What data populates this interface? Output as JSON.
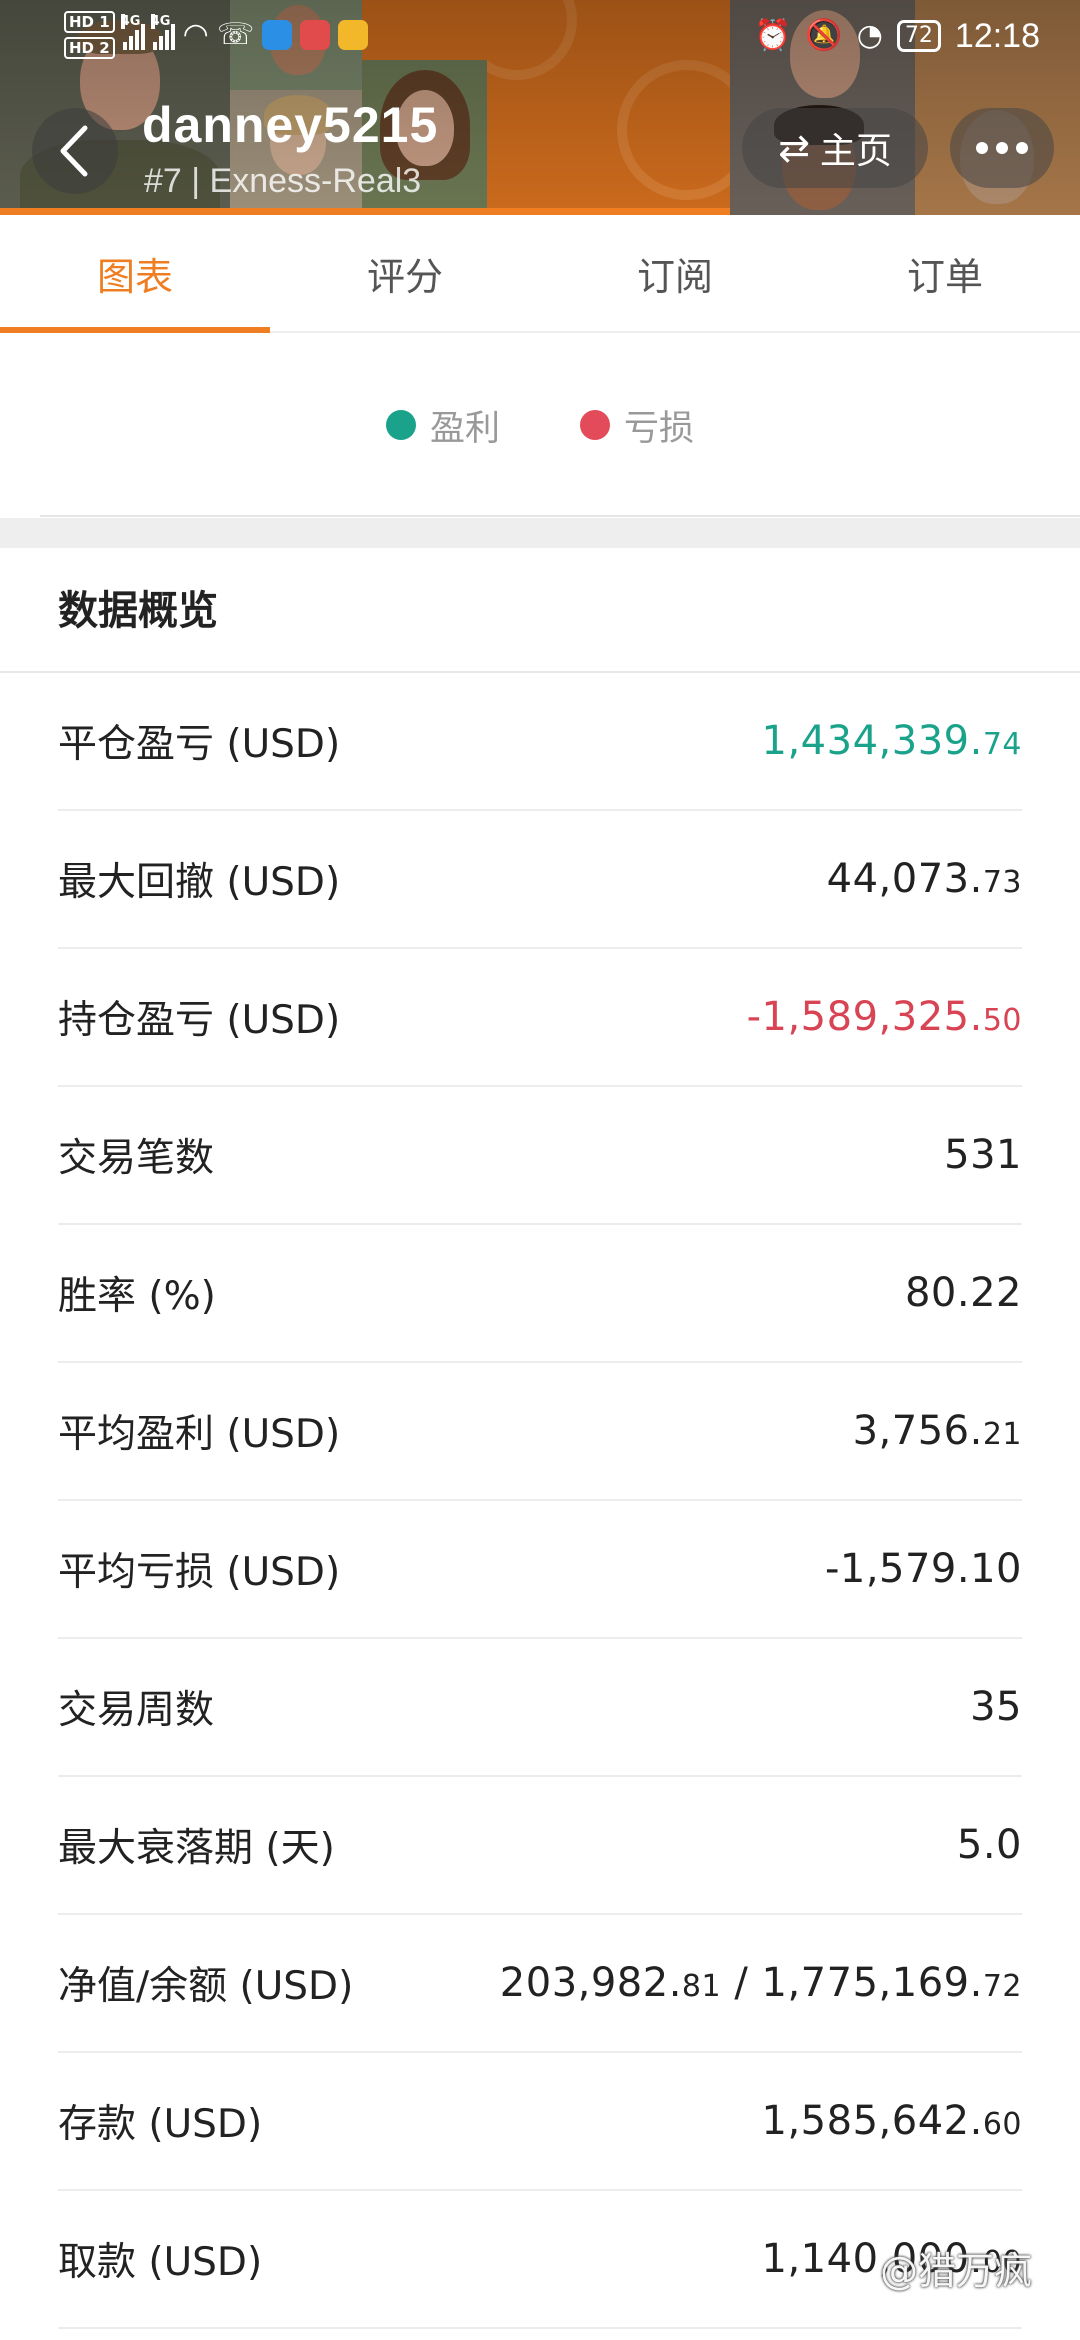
{
  "status_bar": {
    "hd1": "HD 1",
    "hd2": "HD 2",
    "net1": "4G",
    "net2": "4G",
    "battery": "72",
    "time": "12:18"
  },
  "header": {
    "username": "danney5215",
    "subtitle": "#7 | Exness-Real3",
    "home_label": "主页",
    "back_icon": "chevron-left-icon",
    "more_icon": "more-dots-icon"
  },
  "tabs": [
    {
      "label": "图表",
      "active": true
    },
    {
      "label": "评分",
      "active": false
    },
    {
      "label": "订阅",
      "active": false
    },
    {
      "label": "订单",
      "active": false
    }
  ],
  "legend": {
    "profit_label": "盈利",
    "loss_label": "亏损",
    "profit_color": "#1aa38a",
    "loss_color": "#e34a5a"
  },
  "overview": {
    "title": "数据概览",
    "rows": [
      {
        "label": "平仓盈亏 (USD)",
        "int": "1,434,339.",
        "dec": "74",
        "tone": "green"
      },
      {
        "label": "最大回撤 (USD)",
        "int": "44,073.",
        "dec": "73",
        "tone": ""
      },
      {
        "label": "持仓盈亏 (USD)",
        "int": "-1,589,325.",
        "dec": "50",
        "tone": "red"
      },
      {
        "label": "交易笔数",
        "int": "531",
        "dec": "",
        "tone": ""
      },
      {
        "label": "胜率 (%)",
        "int": "80.22",
        "dec": "",
        "tone": ""
      },
      {
        "label": "平均盈利 (USD)",
        "int": "3,756.",
        "dec": "21",
        "tone": ""
      },
      {
        "label": "平均亏损 (USD)",
        "int": "-1,579.10",
        "dec": "",
        "tone": ""
      },
      {
        "label": "交易周数",
        "int": "35",
        "dec": "",
        "tone": ""
      },
      {
        "label": "最大衰落期 (天)",
        "int": "5.0",
        "dec": "",
        "tone": ""
      },
      {
        "label": "净值/余额 (USD)",
        "int": "203,982.",
        "dec": "81",
        "int2": " / 1,775,169.",
        "dec2": "72",
        "tone": ""
      },
      {
        "label": "存款 (USD)",
        "int": "1,585,642.",
        "dec": "60",
        "tone": ""
      },
      {
        "label": "取款 (USD)",
        "int": "1,140,000.",
        "dec": "00",
        "tone": ""
      }
    ]
  },
  "watermark": "@猎万疯",
  "colors": {
    "accent": "#ef7d22",
    "profit": "#1aa38a",
    "loss": "#d84454"
  }
}
